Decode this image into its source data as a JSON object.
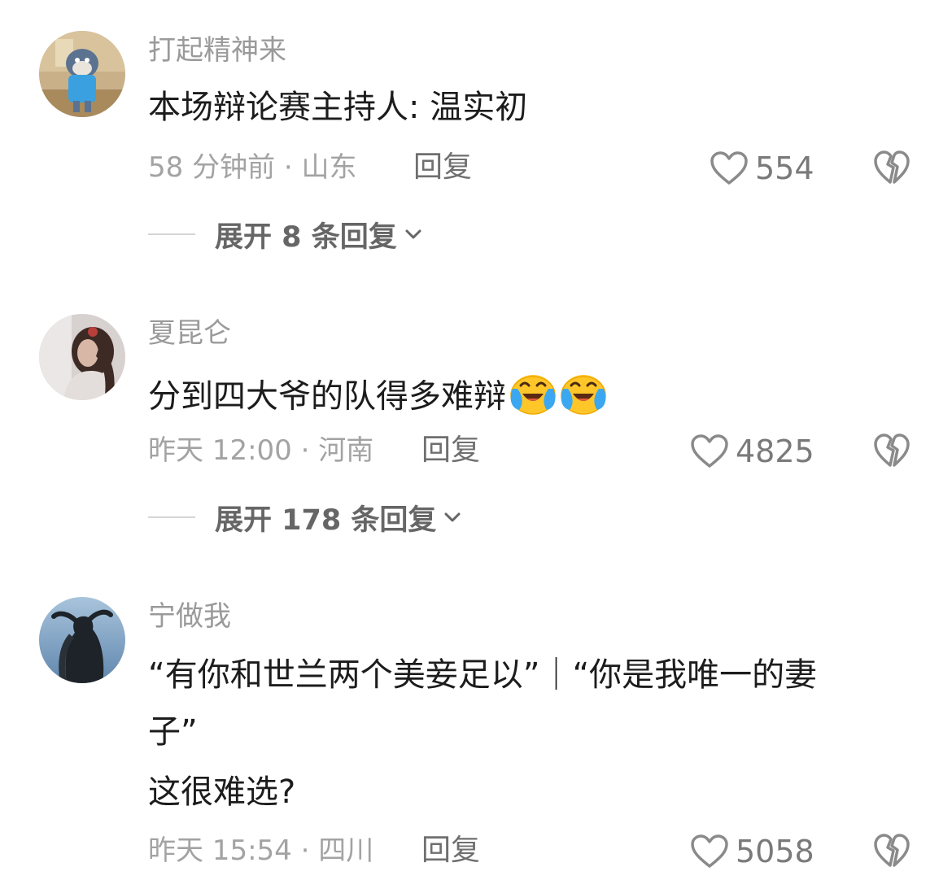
{
  "comments": [
    {
      "username": "打起精神来",
      "lines": [
        "本场辩论赛主持人: 温实初"
      ],
      "meta": "58 分钟前 · 山东",
      "reply_label": "回复",
      "likes": "554",
      "expand_label": "展开 8 条回复",
      "avatar_icon": "cartoon-cat-avatar"
    },
    {
      "username": "夏昆仑",
      "lines": [
        "分到四大爷的队得多难辩"
      ],
      "emojis": [
        "crying-laughing-emoji",
        "crying-laughing-emoji"
      ],
      "meta": "昨天 12:00 · 河南",
      "reply_label": "回复",
      "likes": "4825",
      "expand_label": "展开 178 条回复",
      "avatar_icon": "woman-photo-avatar"
    },
    {
      "username": "宁做我",
      "lines": [
        "“有你和世兰两个美妾足以”｜“你是我唯一的妻",
        "子”",
        "这很难选?"
      ],
      "meta": "昨天 15:54 · 四川",
      "reply_label": "回复",
      "likes": "5058",
      "avatar_icon": "silhouette-photo-avatar"
    }
  ],
  "colors": {
    "username": "#9a9a9a",
    "body_text": "#1c1c1c",
    "meta": "#a3a3a3",
    "icon": "#8a8a8a"
  }
}
